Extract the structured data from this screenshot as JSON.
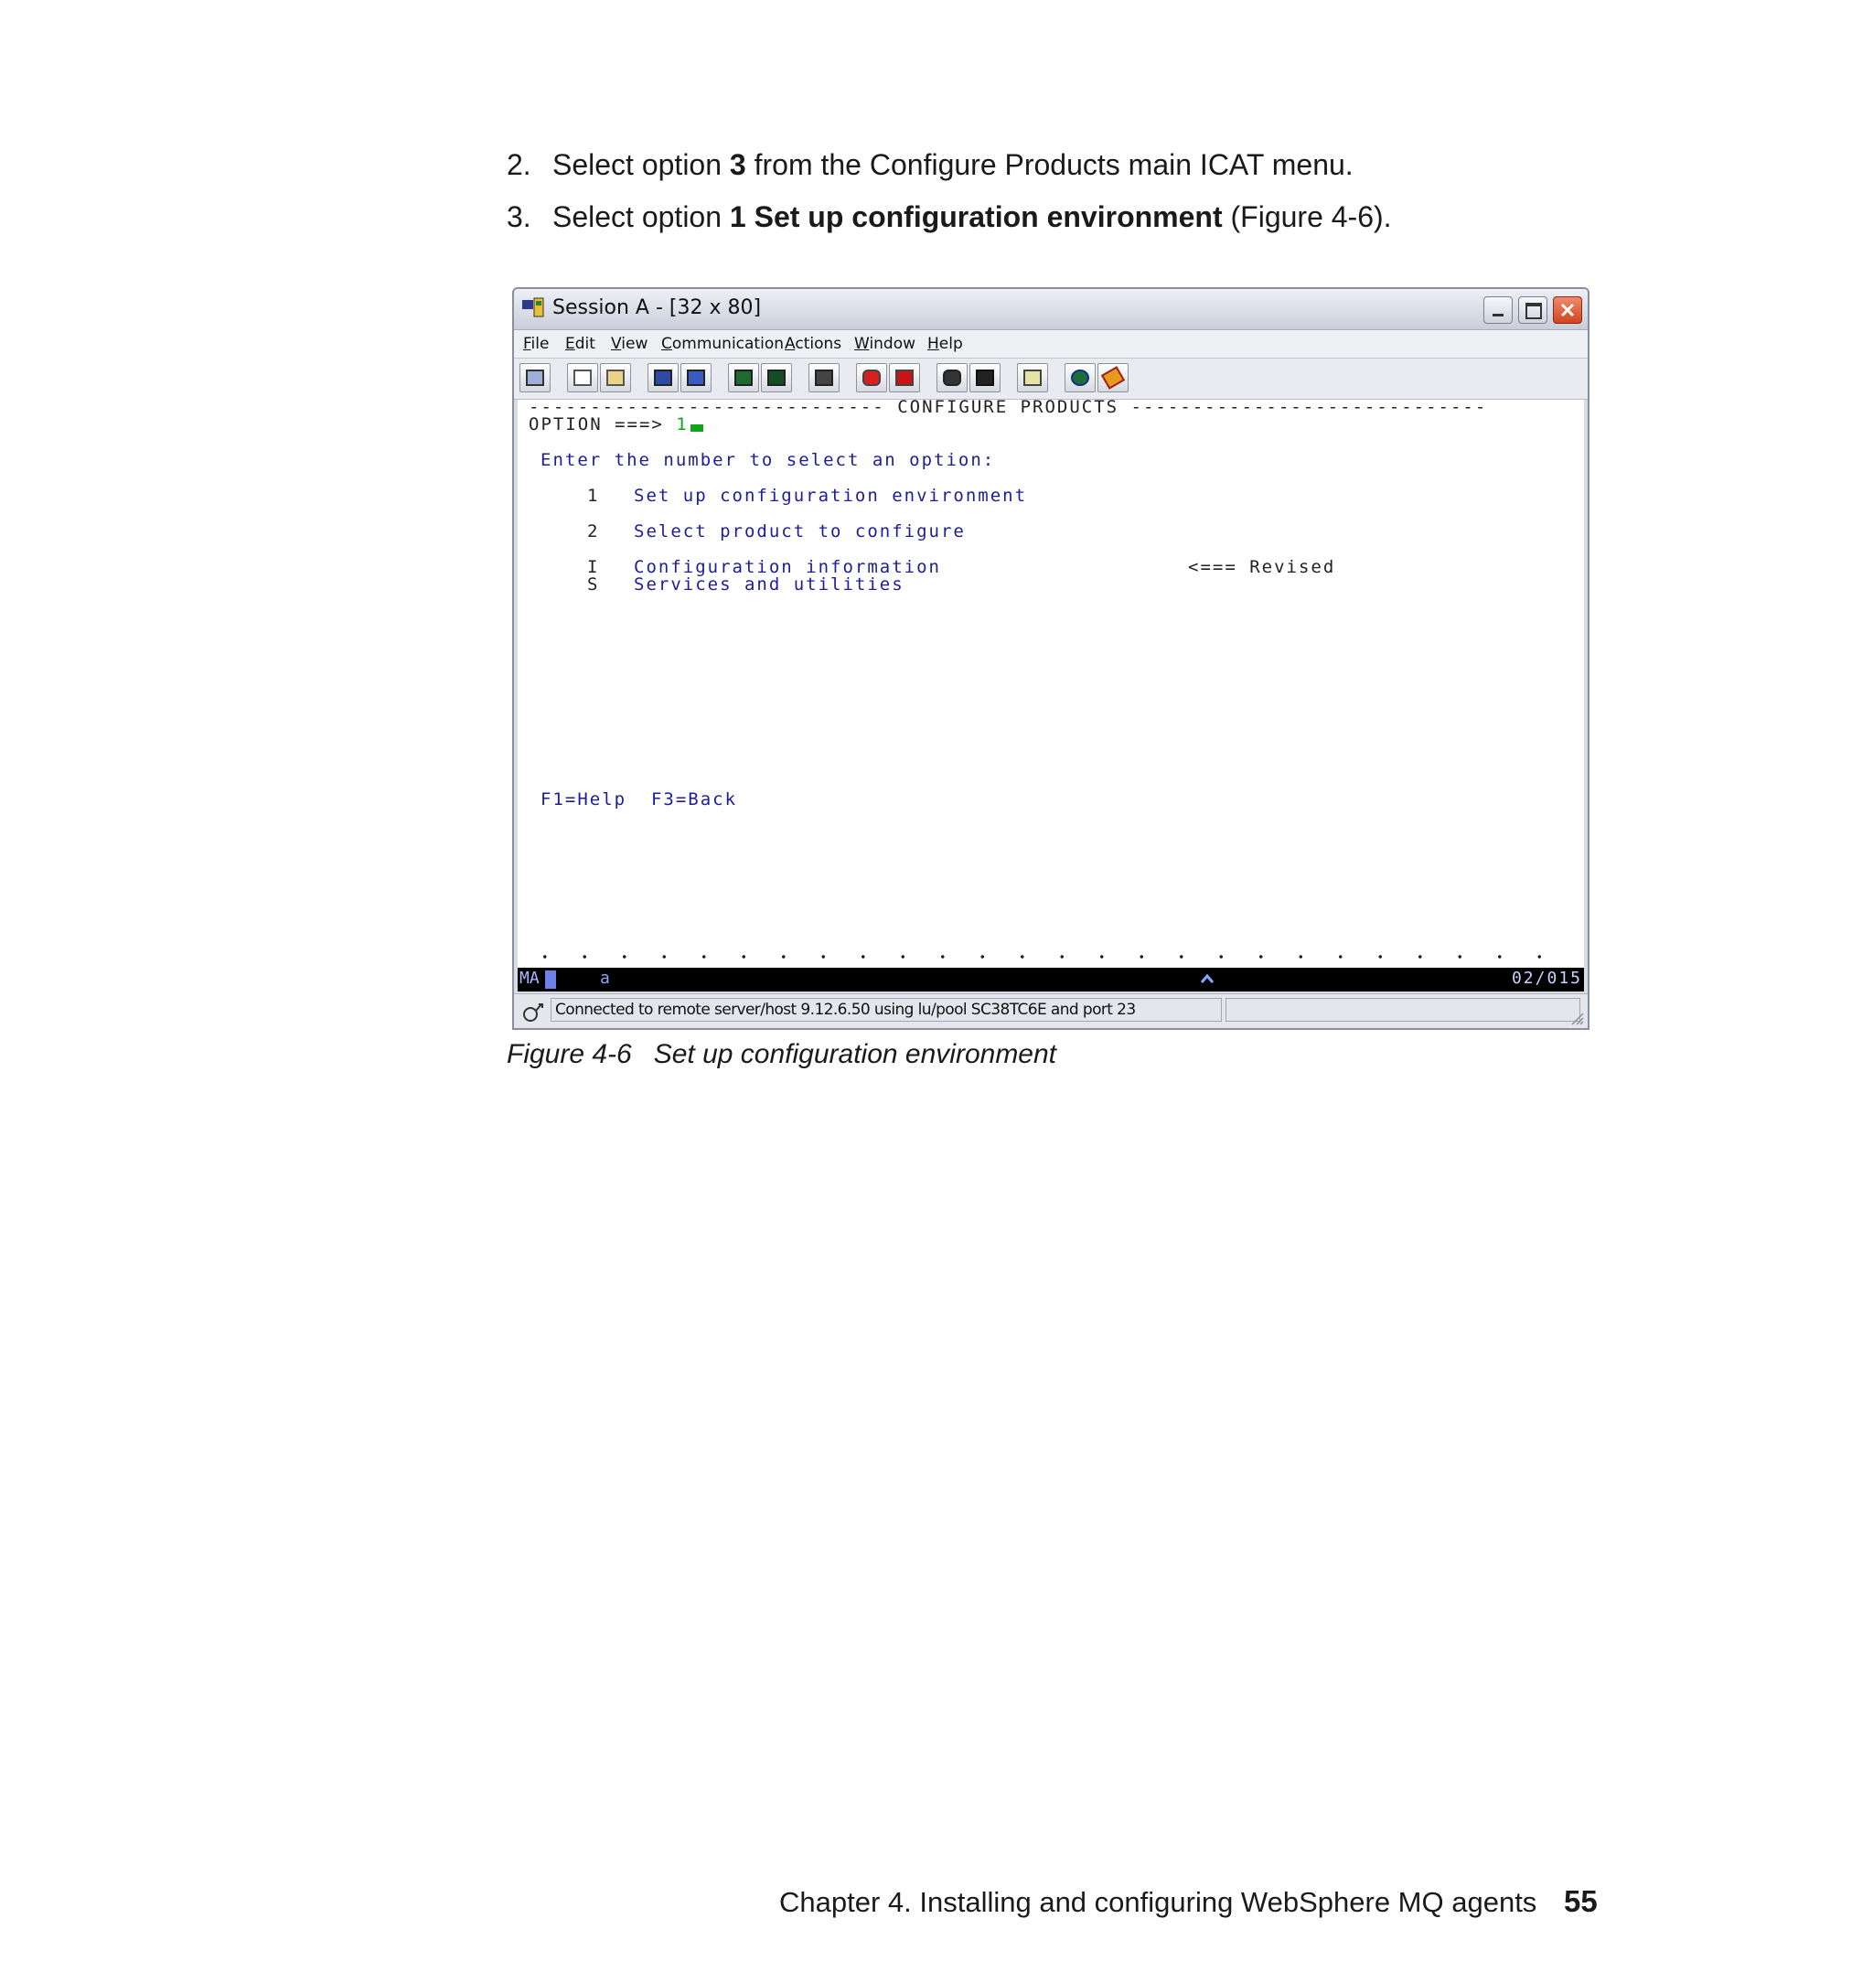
{
  "steps": [
    {
      "number": "2.",
      "text_before": "Select option ",
      "bold": "3",
      "text_after": " from the Configure Products main ICAT menu."
    },
    {
      "number": "3.",
      "text_before": "Select option ",
      "bold": "1 Set up configuration environment",
      "text_after": " (Figure 4-6)."
    }
  ],
  "window": {
    "title": "Session A - [32 x 80]",
    "menus": [
      "File",
      "Edit",
      "View",
      "Communication",
      "Actions",
      "Window",
      "Help"
    ]
  },
  "toolbar_icons": [
    "print-screen-icon",
    "copy-icon",
    "paste-icon",
    "send-file-icon",
    "receive-file-icon",
    "display-setup-icon",
    "color-map-icon",
    "keyboard-map-icon",
    "record-macro-icon",
    "stop-macro-icon",
    "play-macro-icon",
    "macro-setup-icon",
    "clipboard-icon",
    "globe-icon",
    "help-book-icon"
  ],
  "terminal": {
    "header_dashes_left": "-----------------------------",
    "header_title": "CONFIGURE PRODUCTS",
    "header_dashes_right": "-----------------------------",
    "option_label": "OPTION ===>",
    "option_value": "1",
    "prompt": "Enter the number to select an option:",
    "options": [
      {
        "key": "1",
        "label": "Set up configuration environment",
        "note": ""
      },
      {
        "key": "2",
        "label": "Select product to configure",
        "note": ""
      },
      {
        "key": "I",
        "label": "Configuration information",
        "note": "<=== Revised"
      },
      {
        "key": "S",
        "label": "Services and utilities",
        "note": ""
      }
    ],
    "function_keys": "F1=Help  F3=Back"
  },
  "oia": {
    "mode": "MA",
    "indicator": "a",
    "cursor_pos": "02/015"
  },
  "status": {
    "message": "Connected to remote server/host 9.12.6.50 using lu/pool SC38TC6E and port 23"
  },
  "caption": {
    "figure": "Figure 4-6",
    "title": "Set up configuration environment"
  },
  "footer": {
    "chapter": "Chapter 4. Installing and configuring WebSphere MQ agents",
    "page": "55"
  }
}
